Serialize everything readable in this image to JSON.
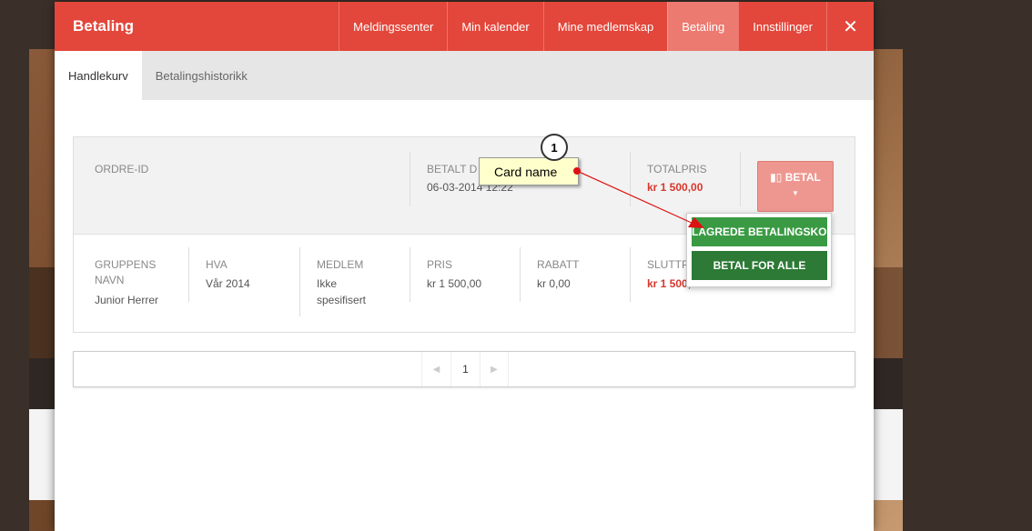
{
  "modal": {
    "title": "Betaling",
    "nav": [
      "Meldingssenter",
      "Min kalender",
      "Mine medlemskap",
      "Betaling",
      "Innstillinger"
    ],
    "close": "✕"
  },
  "subtabs": [
    "Handlekurv",
    "Betalingshistorikk"
  ],
  "order": {
    "order_id_label": "ORDRE-ID",
    "paid_date_label": "BETALT D",
    "paid_date_value": "06-03-2014 12:22",
    "total_label": "TOTALPRIS",
    "total_value": "kr 1 500,00",
    "pay_button": "BETAL"
  },
  "row": {
    "group_label_1": "GRUPPENS",
    "group_label_2": "NAVN",
    "group_value": "Junior Herrer",
    "what_label": "HVA",
    "what_value": "Vår 2014",
    "member_label": "MEDLEM",
    "member_value_1": "Ikke",
    "member_value_2": "spesifisert",
    "price_label": "PRIS",
    "price_value": "kr 1 500,00",
    "discount_label": "RABATT",
    "discount_value": "kr 0,00",
    "final_label": "SLUTTP",
    "final_value": "kr 1 500,00"
  },
  "dropdown": {
    "saved_cards": "LAGREDE BETALINGSKORT",
    "pay_all": "BETAL FOR ALLE"
  },
  "pager": {
    "prev": "◀",
    "page": "1",
    "next": "▶"
  },
  "annotation": {
    "number": "1",
    "text": "Card name"
  },
  "colors": {
    "header_red": "#e3463a",
    "active_tab": "#ec7a70",
    "green": "#3a9a43",
    "dark_green": "#2c7a35",
    "price_red": "#d9362c"
  }
}
